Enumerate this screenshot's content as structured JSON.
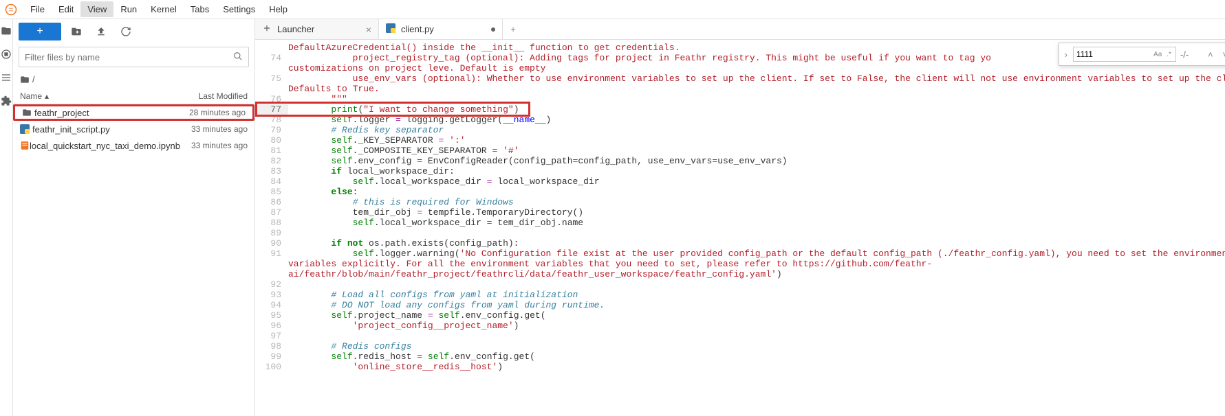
{
  "menu": [
    "File",
    "Edit",
    "View",
    "Run",
    "Kernel",
    "Tabs",
    "Settings",
    "Help"
  ],
  "menu_active_index": 2,
  "sidebar": {
    "filter_placeholder": "Filter files by name",
    "breadcrumb": "/",
    "columns": {
      "name": "Name",
      "modified": "Last Modified"
    },
    "files": [
      {
        "icon": "folder",
        "name": "feathr_project",
        "modified": "28 minutes ago",
        "highlighted": true
      },
      {
        "icon": "python",
        "name": "feathr_init_script.py",
        "modified": "33 minutes ago",
        "highlighted": false
      },
      {
        "icon": "notebook",
        "name": "local_quickstart_nyc_taxi_demo.ipynb",
        "modified": "33 minutes ago",
        "highlighted": false
      }
    ]
  },
  "tabs": [
    {
      "icon": "launcher",
      "label": "Launcher",
      "active": false,
      "dirty": false
    },
    {
      "icon": "python",
      "label": "client.py",
      "active": true,
      "dirty": true
    }
  ],
  "findbar": {
    "value": "1111",
    "count": "-/-"
  },
  "code_lines": [
    {
      "n": "",
      "segs": [
        [
          "c-str",
          "DefaultAzureCredential() inside the __init__ function to get credentials."
        ]
      ]
    },
    {
      "n": "74",
      "segs": [
        [
          "c-str",
          "            project_registry_tag (optional): Adding tags for project in Feathr registry. This might be useful if you want to tag yo"
        ]
      ]
    },
    {
      "n": "",
      "segs": [
        [
          "c-str",
          "customizations on project leve. Default is empty"
        ]
      ]
    },
    {
      "n": "75",
      "segs": [
        [
          "c-str",
          "            use_env_vars (optional): Whether to use environment variables to set up the client. If set to False, the client will not use environment variables to set up the client. "
        ]
      ]
    },
    {
      "n": "",
      "segs": [
        [
          "c-str",
          "Defaults to True."
        ]
      ]
    },
    {
      "n": "76",
      "segs": [
        [
          "c-str",
          "        \"\"\""
        ]
      ]
    },
    {
      "n": "77",
      "highlighted": true,
      "segs": [
        [
          "",
          "        "
        ],
        [
          "c-builtin",
          "print"
        ],
        [
          "",
          "("
        ],
        [
          "c-str",
          "\"I want to change something\""
        ],
        [
          "",
          ")"
        ]
      ]
    },
    {
      "n": "78",
      "segs": [
        [
          "",
          "        "
        ],
        [
          "c-self",
          "self"
        ],
        [
          "",
          ".logger "
        ],
        [
          "c-op",
          "="
        ],
        [
          "",
          " logging.getLogger("
        ],
        [
          "c-name",
          "__name__"
        ],
        [
          "",
          ")"
        ]
      ]
    },
    {
      "n": "79",
      "segs": [
        [
          "",
          "        "
        ],
        [
          "c-cmt",
          "# Redis key separator"
        ]
      ]
    },
    {
      "n": "80",
      "segs": [
        [
          "",
          "        "
        ],
        [
          "c-self",
          "self"
        ],
        [
          "",
          "._KEY_SEPARATOR "
        ],
        [
          "c-op",
          "="
        ],
        [
          "",
          " "
        ],
        [
          "c-str",
          "':'"
        ]
      ]
    },
    {
      "n": "81",
      "segs": [
        [
          "",
          "        "
        ],
        [
          "c-self",
          "self"
        ],
        [
          "",
          "._COMPOSITE_KEY_SEPARATOR "
        ],
        [
          "c-op",
          "="
        ],
        [
          "",
          " "
        ],
        [
          "c-str",
          "'#'"
        ]
      ]
    },
    {
      "n": "82",
      "segs": [
        [
          "",
          "        "
        ],
        [
          "c-self",
          "self"
        ],
        [
          "",
          ".env_config "
        ],
        [
          "c-op",
          "="
        ],
        [
          "",
          " EnvConfigReader(config_path"
        ],
        [
          "c-op",
          "="
        ],
        [
          "",
          "config_path, use_env_vars"
        ],
        [
          "c-op",
          "="
        ],
        [
          "",
          "use_env_vars)"
        ]
      ]
    },
    {
      "n": "83",
      "segs": [
        [
          "",
          "        "
        ],
        [
          "c-kw",
          "if"
        ],
        [
          "",
          " local_workspace_dir:"
        ]
      ]
    },
    {
      "n": "84",
      "segs": [
        [
          "",
          "            "
        ],
        [
          "c-self",
          "self"
        ],
        [
          "",
          ".local_workspace_dir "
        ],
        [
          "c-op",
          "="
        ],
        [
          "",
          " local_workspace_dir"
        ]
      ]
    },
    {
      "n": "85",
      "segs": [
        [
          "",
          "        "
        ],
        [
          "c-kw",
          "else"
        ],
        [
          "",
          ":"
        ]
      ]
    },
    {
      "n": "86",
      "segs": [
        [
          "",
          "            "
        ],
        [
          "c-cmt",
          "# this is required for Windows"
        ]
      ]
    },
    {
      "n": "87",
      "segs": [
        [
          "",
          "            tem_dir_obj "
        ],
        [
          "c-op",
          "="
        ],
        [
          "",
          " tempfile.TemporaryDirectory()"
        ]
      ]
    },
    {
      "n": "88",
      "segs": [
        [
          "",
          "            "
        ],
        [
          "c-self",
          "self"
        ],
        [
          "",
          ".local_workspace_dir "
        ],
        [
          "c-op",
          "="
        ],
        [
          "",
          " tem_dir_obj.name"
        ]
      ]
    },
    {
      "n": "89",
      "segs": [
        [
          "",
          ""
        ]
      ]
    },
    {
      "n": "90",
      "segs": [
        [
          "",
          "        "
        ],
        [
          "c-kw",
          "if"
        ],
        [
          "",
          " "
        ],
        [
          "c-kw",
          "not"
        ],
        [
          "",
          " os.path.exists(config_path):"
        ]
      ]
    },
    {
      "n": "91",
      "segs": [
        [
          "",
          "            "
        ],
        [
          "c-self",
          "self"
        ],
        [
          "",
          ".logger.warning("
        ],
        [
          "c-str",
          "'No Configuration file exist at the user provided config_path or the default config_path (./feathr_config.yaml), you need to set the environment "
        ]
      ]
    },
    {
      "n": "",
      "segs": [
        [
          "c-str",
          "variables explicitly. For all the environment variables that you need to set, please refer to https://github.com/feathr-"
        ]
      ]
    },
    {
      "n": "",
      "segs": [
        [
          "c-str",
          "ai/feathr/blob/main/feathr_project/feathrcli/data/feathr_user_workspace/feathr_config.yaml'"
        ],
        [
          "",
          ")"
        ]
      ]
    },
    {
      "n": "92",
      "segs": [
        [
          "",
          ""
        ]
      ]
    },
    {
      "n": "93",
      "segs": [
        [
          "",
          "        "
        ],
        [
          "c-cmt",
          "# Load all configs from yaml at initialization"
        ]
      ]
    },
    {
      "n": "94",
      "segs": [
        [
          "",
          "        "
        ],
        [
          "c-cmt",
          "# DO NOT load any configs from yaml during runtime."
        ]
      ]
    },
    {
      "n": "95",
      "segs": [
        [
          "",
          "        "
        ],
        [
          "c-self",
          "self"
        ],
        [
          "",
          ".project_name "
        ],
        [
          "c-op",
          "="
        ],
        [
          "",
          " "
        ],
        [
          "c-self",
          "self"
        ],
        [
          "",
          ".env_config.get("
        ]
      ]
    },
    {
      "n": "96",
      "segs": [
        [
          "",
          "            "
        ],
        [
          "c-str",
          "'project_config__project_name'"
        ],
        [
          "",
          ")"
        ]
      ]
    },
    {
      "n": "97",
      "segs": [
        [
          "",
          ""
        ]
      ]
    },
    {
      "n": "98",
      "segs": [
        [
          "",
          "        "
        ],
        [
          "c-cmt",
          "# Redis configs"
        ]
      ]
    },
    {
      "n": "99",
      "segs": [
        [
          "",
          "        "
        ],
        [
          "c-self",
          "self"
        ],
        [
          "",
          ".redis_host "
        ],
        [
          "c-op",
          "="
        ],
        [
          "",
          " "
        ],
        [
          "c-self",
          "self"
        ],
        [
          "",
          ".env_config.get("
        ]
      ]
    },
    {
      "n": "100",
      "segs": [
        [
          "",
          "            "
        ],
        [
          "c-str",
          "'online_store__redis__host'"
        ],
        [
          "",
          ")"
        ]
      ]
    }
  ]
}
